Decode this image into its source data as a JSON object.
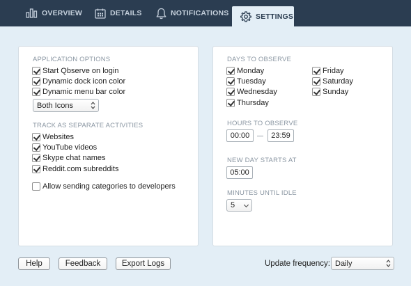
{
  "tabs": [
    {
      "label": "OVERVIEW",
      "icon": "bar-chart-icon"
    },
    {
      "label": "DETAILS",
      "icon": "calendar-icon"
    },
    {
      "label": "NOTIFICATIONS",
      "icon": "bell-icon"
    },
    {
      "label": "SETTINGS",
      "icon": "gear-icon",
      "active": true
    }
  ],
  "app_options": {
    "title": "APPLICATION OPTIONS",
    "items": [
      {
        "label": "Start Qbserve on login",
        "checked": true
      },
      {
        "label": "Dynamic dock icon color",
        "checked": true
      },
      {
        "label": "Dynamic menu bar color",
        "checked": true
      }
    ],
    "icons_select": "Both Icons"
  },
  "track": {
    "title": "TRACK AS SEPARATE ACTIVITIES",
    "items": [
      {
        "label": "Websites",
        "checked": true
      },
      {
        "label": "YouTube videos",
        "checked": true
      },
      {
        "label": "Skype chat names",
        "checked": true
      },
      {
        "label": "Reddit.com subreddits",
        "checked": true
      }
    ]
  },
  "allow_sending": {
    "label": "Allow sending categories to developers",
    "checked": false
  },
  "days": {
    "title": "DAYS TO OBSERVE",
    "items": [
      {
        "label": "Monday",
        "checked": true
      },
      {
        "label": "Tuesday",
        "checked": true
      },
      {
        "label": "Wednesday",
        "checked": true
      },
      {
        "label": "Thursday",
        "checked": true
      },
      {
        "label": "Friday",
        "checked": true
      },
      {
        "label": "Saturday",
        "checked": true
      },
      {
        "label": "Sunday",
        "checked": true
      }
    ]
  },
  "hours": {
    "title": "HOURS TO OBSERVE",
    "start": "00:00",
    "end": "23:59"
  },
  "new_day": {
    "title": "NEW DAY STARTS AT",
    "value": "05:00"
  },
  "idle": {
    "title": "MINUTES UNTIL IDLE",
    "value": "5"
  },
  "footer": {
    "help": "Help",
    "feedback": "Feedback",
    "export_logs": "Export Logs",
    "update_label": "Update frequency:",
    "update_value": "Daily"
  },
  "colors": {
    "header_bg": "#2b3d51",
    "page_bg": "#e3eef6",
    "panel_bg": "#ffffff"
  }
}
